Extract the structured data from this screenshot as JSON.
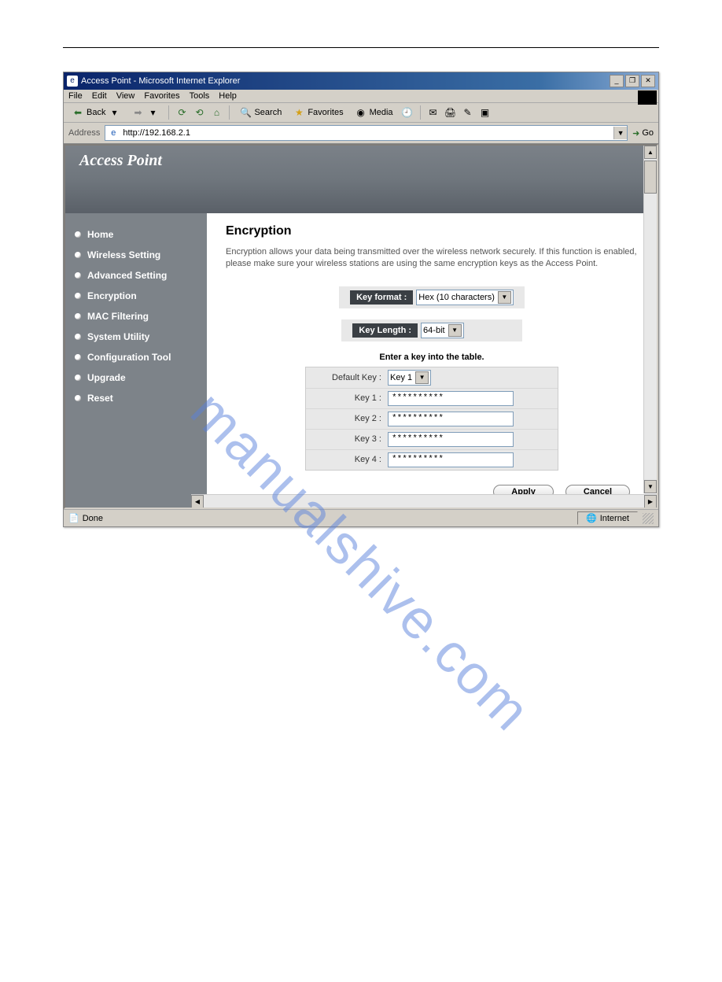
{
  "window": {
    "title": "Access Point - Microsoft Internet Explorer",
    "minimize": "_",
    "restore": "❐",
    "close": "✕"
  },
  "menus": [
    "File",
    "Edit",
    "View",
    "Favorites",
    "Tools",
    "Help"
  ],
  "toolbar": {
    "back": "Back",
    "search": "Search",
    "favorites": "Favorites",
    "media": "Media"
  },
  "address": {
    "label": "Address",
    "url": "http://192.168.2.1",
    "go": "Go"
  },
  "brand": "Access Point",
  "sidebar": {
    "items": [
      {
        "label": "Home"
      },
      {
        "label": "Wireless Setting"
      },
      {
        "label": "Advanced Setting"
      },
      {
        "label": "Encryption"
      },
      {
        "label": "MAC Filtering"
      },
      {
        "label": "System Utility"
      },
      {
        "label": "Configuration Tool"
      },
      {
        "label": "Upgrade"
      },
      {
        "label": "Reset"
      }
    ]
  },
  "page": {
    "heading": "Encryption",
    "description": "Encryption allows your data being transmitted over the wireless network securely. If this function is enabled, please make sure your wireless stations are using the same encryption keys as the Access Point.",
    "key_format_label": "Key format :",
    "key_format_value": "Hex (10 characters)",
    "key_length_label": "Key Length :",
    "key_length_value": "64-bit",
    "table_heading": "Enter a key into the table.",
    "default_key_label": "Default Key :",
    "default_key_value": "Key 1",
    "keys": [
      {
        "label": "Key 1 :",
        "value": "**********"
      },
      {
        "label": "Key 2 :",
        "value": "**********"
      },
      {
        "label": "Key 3 :",
        "value": "**********"
      },
      {
        "label": "Key 4 :",
        "value": "**********"
      }
    ],
    "apply": "Apply",
    "cancel": "Cancel"
  },
  "status": {
    "left": "Done",
    "zone": "Internet"
  },
  "watermark": "manualshive.com"
}
